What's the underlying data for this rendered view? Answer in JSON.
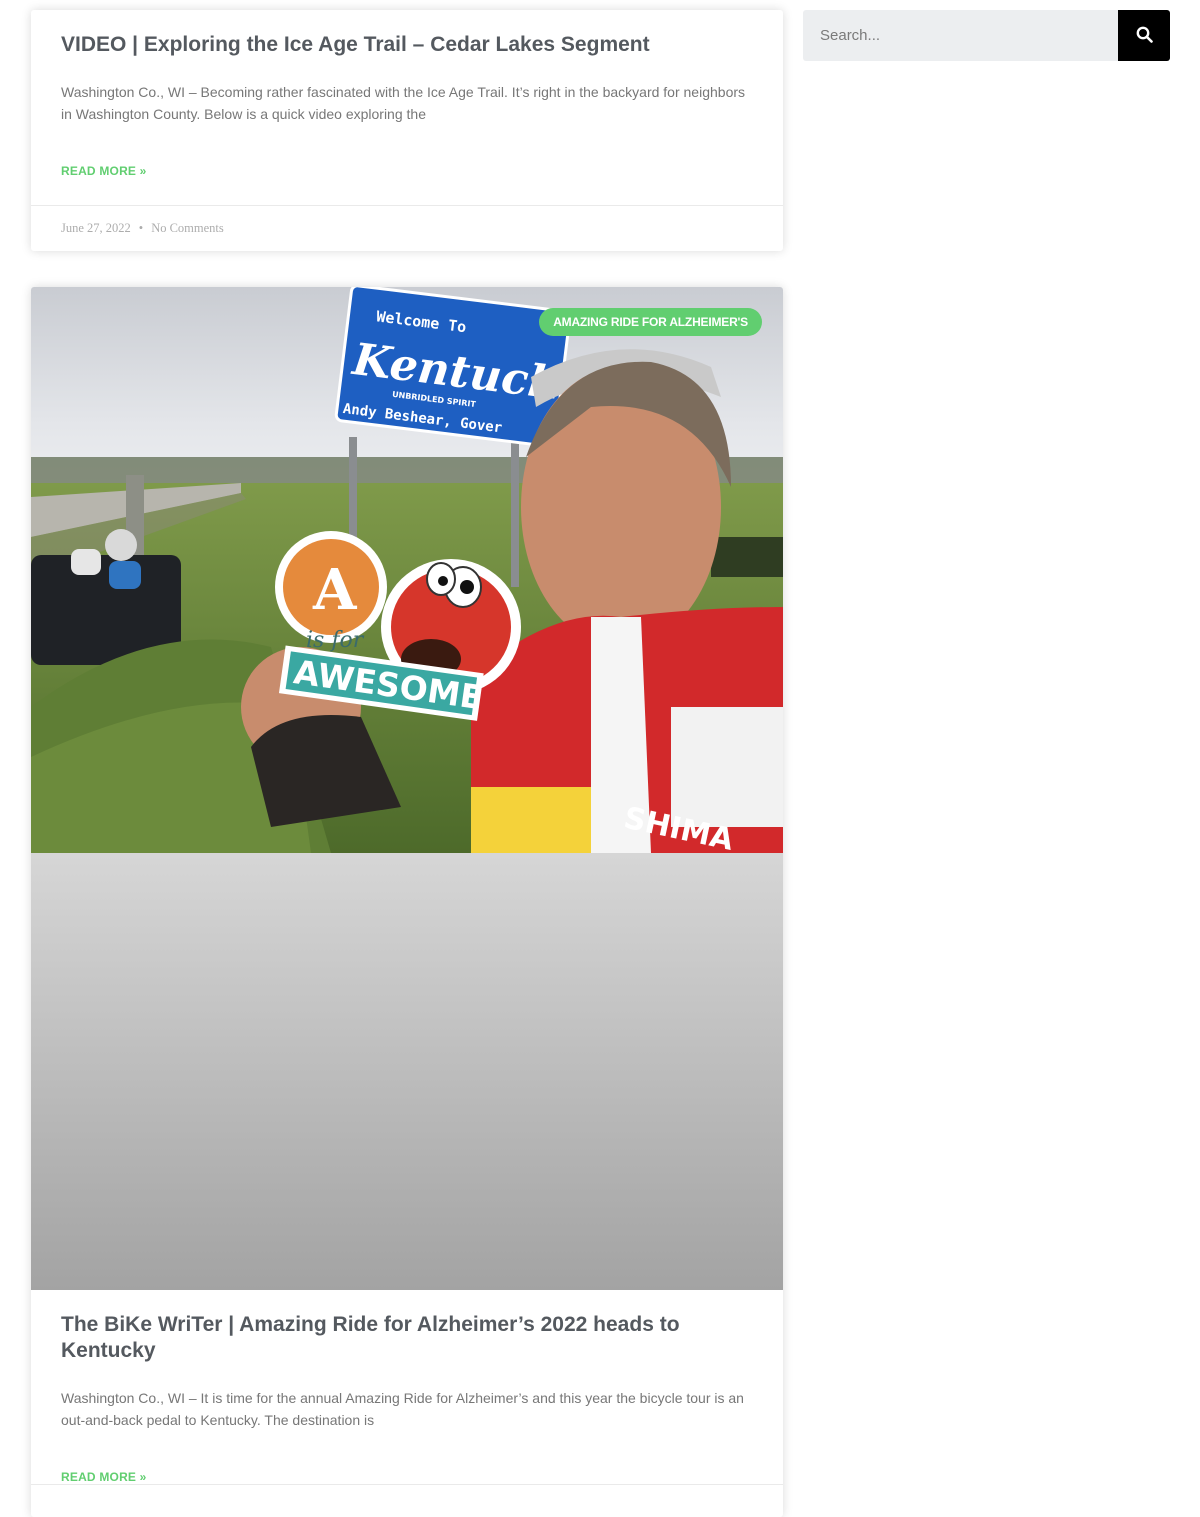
{
  "posts": [
    {
      "title": "VIDEO | Exploring the Ice Age Trail – Cedar Lakes Segment",
      "excerpt": "Washington Co., WI – Becoming rather fascinated with the Ice Age Trail. It’s right in the backyard for neighbors in Washington County. Below is a quick video exploring the",
      "read_more": "READ MORE »",
      "date": "June 27, 2022",
      "separator": "•",
      "comments": "No Comments"
    },
    {
      "badge": "AMAZING RIDE FOR ALZHEIMER'S",
      "title": "The BiKe WriTer | Amazing Ride for Alzheimer’s 2022 heads to Kentucky",
      "excerpt": "Washington Co., WI – It is time for the annual Amazing Ride for Alzheimer’s and this year the bicycle tour is an out-and-back pedal to Kentucky. The destination is",
      "read_more": "READ MORE »",
      "photo": {
        "sign_welcome": "Welcome To",
        "sign_state": "Kentucky",
        "sign_tagline": "UNBRIDLED SPIRIT",
        "sign_governor": "Andy Beshear, Gover",
        "sticker_letter": "A",
        "sticker_mid": "is for",
        "sticker_word": "AWESOME",
        "jersey_brand": "SHIMA"
      }
    }
  ],
  "search": {
    "placeholder": "Search...",
    "icon": "search-icon"
  },
  "colors": {
    "accent": "#61ce70",
    "title": "#54595f",
    "text": "#777777",
    "meta": "#adadad",
    "search_bg": "#eceef0",
    "search_btn": "#000000"
  }
}
